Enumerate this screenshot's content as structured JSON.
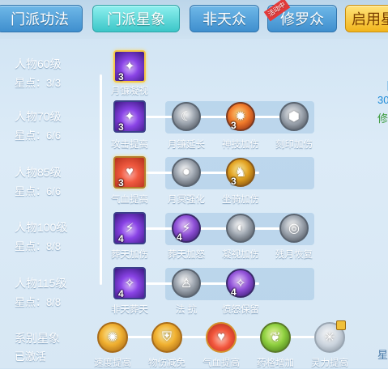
{
  "tabs": [
    {
      "label": "门派功法"
    },
    {
      "label": "门派星象"
    },
    {
      "label": "非天众"
    },
    {
      "label": "修罗众"
    },
    {
      "label": "启用星"
    }
  ],
  "tab_badge": "活动中",
  "levels": [
    {
      "title": "人物60级",
      "points": "星点：3/3"
    },
    {
      "title": "人物70级",
      "points": "星点：6/6"
    },
    {
      "title": "人物85级",
      "points": "星点：6/6"
    },
    {
      "title": "人物100级",
      "points": "星点：8/8"
    },
    {
      "title": "人物115级",
      "points": "星点：8/8"
    }
  ],
  "series": {
    "title": "系别星象",
    "status": "已激活"
  },
  "skills": {
    "r1": [
      {
        "name": "月镰凝视",
        "count": "3"
      }
    ],
    "r2": [
      {
        "name": "攻击提高",
        "count": "3"
      },
      {
        "name": "月镰延长",
        "count": ""
      },
      {
        "name": "神技加伤",
        "count": "3"
      },
      {
        "name": "刻印加伤",
        "count": ""
      }
    ],
    "r3": [
      {
        "name": "气血提高",
        "count": "3"
      },
      {
        "name": "月冥强化",
        "count": ""
      },
      {
        "name": "坐骑加伤",
        "count": "3"
      }
    ],
    "r4": [
      {
        "name": "葬天加伤",
        "count": "4"
      },
      {
        "name": "葬天加怒",
        "count": "4"
      },
      {
        "name": "凝视加伤",
        "count": ""
      },
      {
        "name": "残月恢复",
        "count": ""
      }
    ],
    "r5": [
      {
        "name": "非天葬天",
        "count": "4"
      },
      {
        "name": "法 抗",
        "count": ""
      },
      {
        "name": "愤怒保留",
        "count": "4"
      }
    ],
    "bottom": [
      {
        "name": "速度提高"
      },
      {
        "name": "物伤减免"
      },
      {
        "name": "气血提高"
      },
      {
        "name": "药格增加"
      },
      {
        "name": "灵力提高"
      }
    ]
  },
  "side": {
    "a": "【",
    "b": "30",
    "c": "修",
    "d": "星"
  }
}
